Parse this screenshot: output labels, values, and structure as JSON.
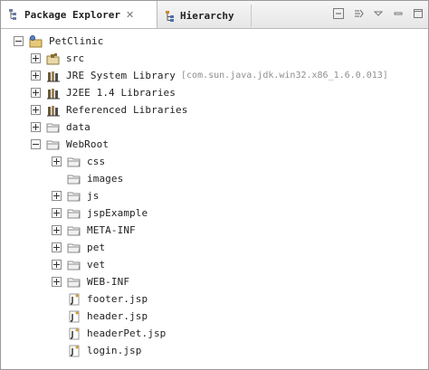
{
  "tabs": {
    "active": {
      "label": "Package Explorer",
      "close": "✕"
    },
    "inactive": {
      "label": "Hierarchy"
    }
  },
  "toolbar": {
    "icons": [
      "collapse-all-icon",
      "link-with-editor-icon",
      "view-menu-icon",
      "minimize-icon",
      "maximize-icon"
    ]
  },
  "tree": {
    "project": "PetClinic",
    "src": "src",
    "jre": "JRE System Library",
    "jre_decor": "[com.sun.java.jdk.win32.x86_1.6.0.013]",
    "j2ee": "J2EE 1.4 Libraries",
    "referenced": "Referenced Libraries",
    "data": "data",
    "webroot": "WebRoot",
    "css": "css",
    "images": "images",
    "js": "js",
    "jspExample": "jspExample",
    "metainf": "META-INF",
    "pet": "pet",
    "vet": "vet",
    "webinf": "WEB-INF",
    "footer": "footer.jsp",
    "header": "header.jsp",
    "headerPet": "headerPet.jsp",
    "login": "login.jsp"
  }
}
